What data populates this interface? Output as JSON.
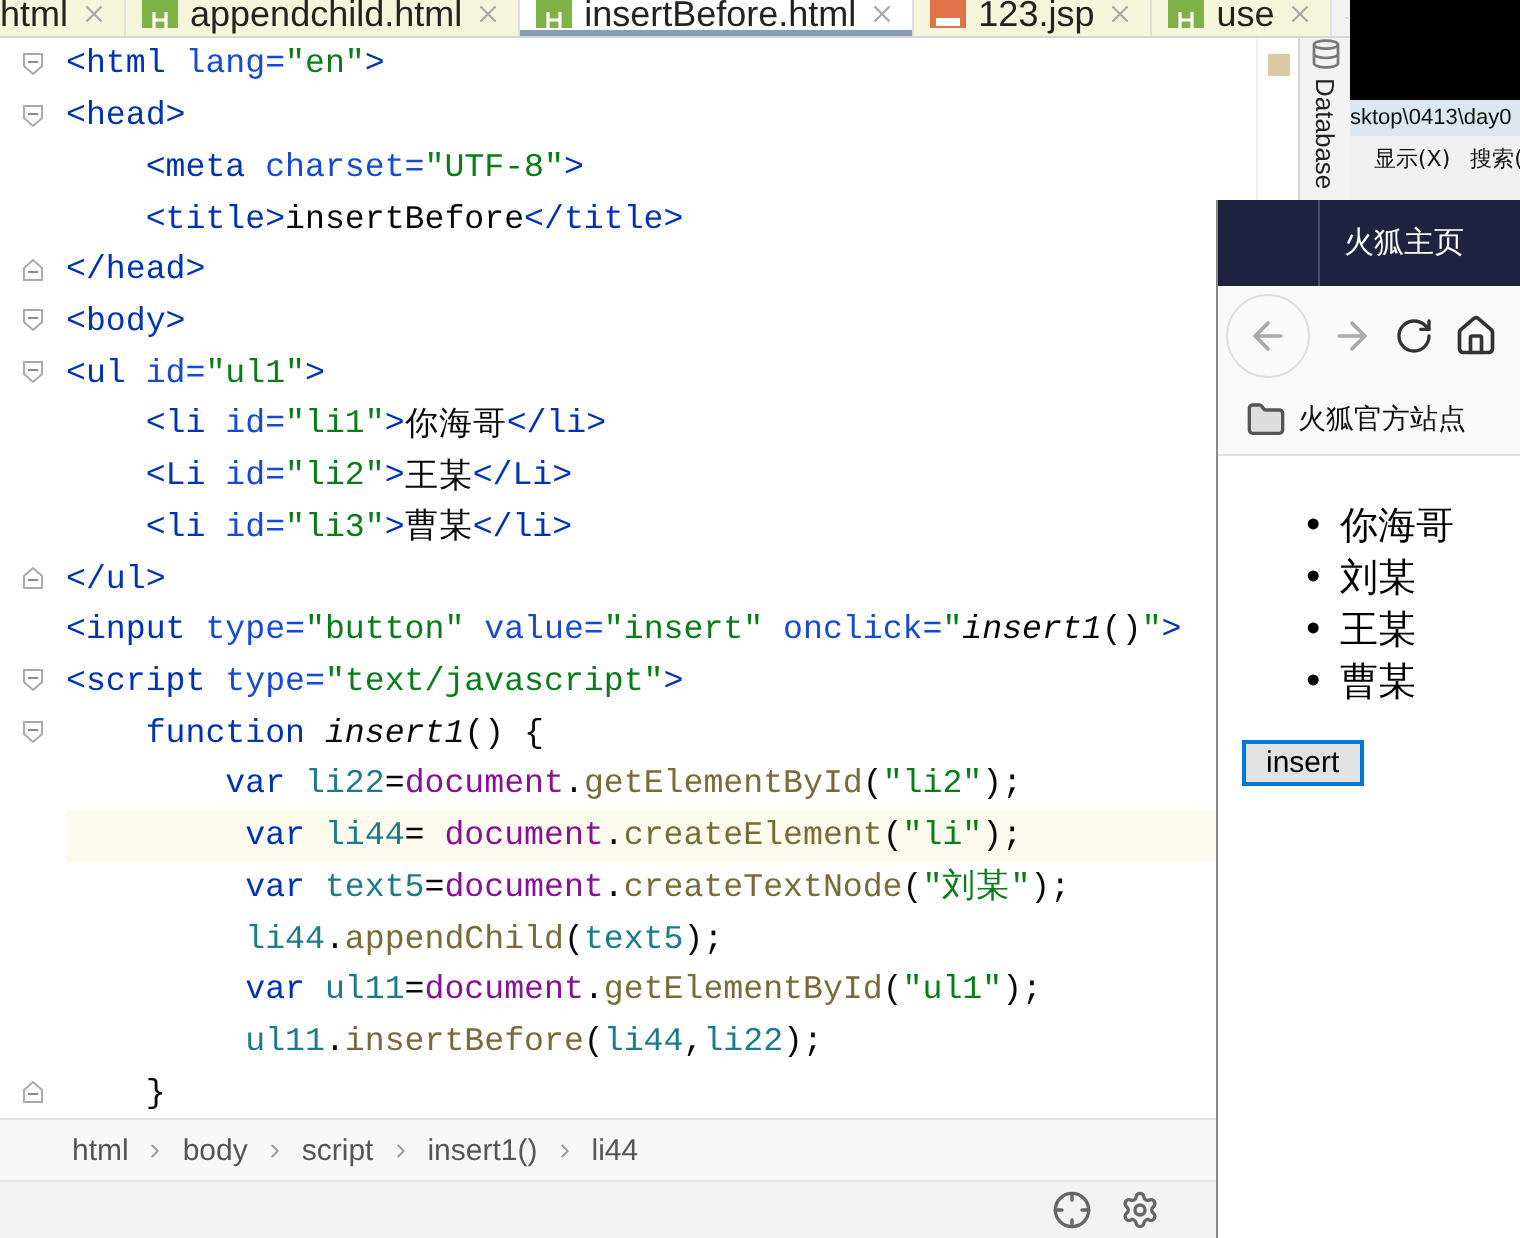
{
  "tabs": [
    {
      "label": "html",
      "kind": "cut",
      "selected": false
    },
    {
      "label": "appendchild.html",
      "kind": "html",
      "selected": false
    },
    {
      "label": "insertBefore.html",
      "kind": "html",
      "selected": true
    },
    {
      "label": "123.jsp",
      "kind": "jsp",
      "selected": false
    },
    {
      "label": "use",
      "kind": "html",
      "selected": false
    }
  ],
  "side_panel": {
    "label": "Database"
  },
  "editor": {
    "lines": [
      {
        "kind": "opening",
        "highlighted": false,
        "tokens": [
          {
            "kind": "tag",
            "text": "<html "
          },
          {
            "kind": "attr",
            "text": "lang="
          },
          {
            "kind": "str",
            "text": "\"en\""
          },
          {
            "kind": "tag",
            "text": ">"
          }
        ]
      },
      {
        "kind": "opening",
        "highlighted": false,
        "tokens": [
          {
            "kind": "tag",
            "text": "<head>"
          }
        ]
      },
      {
        "kind": "plain",
        "highlighted": false,
        "tokens": [
          {
            "kind": "tag",
            "text": "    <meta "
          },
          {
            "kind": "attr",
            "text": "charset="
          },
          {
            "kind": "str",
            "text": "\"UTF-8\""
          },
          {
            "kind": "tag",
            "text": ">"
          }
        ]
      },
      {
        "kind": "plain",
        "highlighted": false,
        "tokens": [
          {
            "kind": "tag",
            "text": "    <title>"
          },
          {
            "kind": "text",
            "text": "insertBefore"
          },
          {
            "kind": "tag",
            "text": "</title>"
          }
        ]
      },
      {
        "kind": "closing",
        "highlighted": false,
        "tokens": [
          {
            "kind": "tag",
            "text": "</head>"
          }
        ]
      },
      {
        "kind": "opening",
        "highlighted": false,
        "tokens": [
          {
            "kind": "tag",
            "text": "<body>"
          }
        ]
      },
      {
        "kind": "opening",
        "highlighted": false,
        "tokens": [
          {
            "kind": "tag",
            "text": "<ul "
          },
          {
            "kind": "attr",
            "text": "id="
          },
          {
            "kind": "str",
            "text": "\"ul1\""
          },
          {
            "kind": "tag",
            "text": ">"
          }
        ]
      },
      {
        "kind": "plain",
        "highlighted": false,
        "tokens": [
          {
            "kind": "tag",
            "text": "    <li "
          },
          {
            "kind": "attr",
            "text": "id="
          },
          {
            "kind": "str",
            "text": "\"li1\""
          },
          {
            "kind": "tag",
            "text": ">"
          },
          {
            "kind": "text",
            "text": "你海哥"
          },
          {
            "kind": "tag",
            "text": "</li>"
          }
        ]
      },
      {
        "kind": "plain",
        "highlighted": false,
        "tokens": [
          {
            "kind": "tag",
            "text": "    <Li "
          },
          {
            "kind": "attr",
            "text": "id="
          },
          {
            "kind": "str",
            "text": "\"li2\""
          },
          {
            "kind": "tag",
            "text": ">"
          },
          {
            "kind": "text",
            "text": "王某"
          },
          {
            "kind": "tag",
            "text": "</Li>"
          }
        ]
      },
      {
        "kind": "plain",
        "highlighted": false,
        "tokens": [
          {
            "kind": "tag",
            "text": "    <li "
          },
          {
            "kind": "attr",
            "text": "id="
          },
          {
            "kind": "str",
            "text": "\"li3\""
          },
          {
            "kind": "tag",
            "text": ">"
          },
          {
            "kind": "text",
            "text": "曹某"
          },
          {
            "kind": "tag",
            "text": "</li>"
          }
        ]
      },
      {
        "kind": "closing",
        "highlighted": false,
        "tokens": [
          {
            "kind": "tag",
            "text": "</ul>"
          }
        ]
      },
      {
        "kind": "plain",
        "highlighted": false,
        "tokens": [
          {
            "kind": "tag",
            "text": "<input "
          },
          {
            "kind": "attr",
            "text": "type="
          },
          {
            "kind": "str",
            "text": "\"button\""
          },
          {
            "kind": "attr",
            "text": " value="
          },
          {
            "kind": "str",
            "text": "\"insert\""
          },
          {
            "kind": "attr",
            "text": " onclick="
          },
          {
            "kind": "str",
            "text": "\""
          },
          {
            "kind": "fn",
            "text": "insert1"
          },
          {
            "kind": "text",
            "text": "()"
          },
          {
            "kind": "str",
            "text": "\""
          },
          {
            "kind": "tag",
            "text": ">"
          }
        ]
      },
      {
        "kind": "opening",
        "highlighted": false,
        "tokens": [
          {
            "kind": "tag",
            "text": "<script "
          },
          {
            "kind": "attr",
            "text": "type="
          },
          {
            "kind": "str",
            "text": "\"text/javascript\""
          },
          {
            "kind": "tag",
            "text": ">"
          }
        ]
      },
      {
        "kind": "opening",
        "highlighted": false,
        "tokens": [
          {
            "kind": "kw",
            "text": "    function "
          },
          {
            "kind": "fn",
            "text": "insert1"
          },
          {
            "kind": "text",
            "text": "() {"
          }
        ]
      },
      {
        "kind": "plain",
        "highlighted": false,
        "tokens": [
          {
            "kind": "kw",
            "text": "        var "
          },
          {
            "kind": "ident",
            "text": "li22"
          },
          {
            "kind": "text",
            "text": "="
          },
          {
            "kind": "obj",
            "text": "document"
          },
          {
            "kind": "text",
            "text": "."
          },
          {
            "kind": "method",
            "text": "getElementById"
          },
          {
            "kind": "text",
            "text": "("
          },
          {
            "kind": "str",
            "text": "\"li2\""
          },
          {
            "kind": "text",
            "text": ");"
          }
        ]
      },
      {
        "kind": "plain",
        "highlighted": true,
        "tokens": [
          {
            "kind": "kw",
            "text": "         var "
          },
          {
            "kind": "ident",
            "text": "li44"
          },
          {
            "kind": "text",
            "text": "= "
          },
          {
            "kind": "obj",
            "text": "document"
          },
          {
            "kind": "text",
            "text": "."
          },
          {
            "kind": "method",
            "text": "createElement"
          },
          {
            "kind": "text",
            "text": "("
          },
          {
            "kind": "str",
            "text": "\"li\""
          },
          {
            "kind": "text",
            "text": ");"
          }
        ]
      },
      {
        "kind": "plain",
        "highlighted": false,
        "tokens": [
          {
            "kind": "kw",
            "text": "         var "
          },
          {
            "kind": "ident",
            "text": "text5"
          },
          {
            "kind": "text",
            "text": "="
          },
          {
            "kind": "obj",
            "text": "document"
          },
          {
            "kind": "text",
            "text": "."
          },
          {
            "kind": "method",
            "text": "createTextNode"
          },
          {
            "kind": "text",
            "text": "("
          },
          {
            "kind": "str",
            "text": "\"刘某\""
          },
          {
            "kind": "text",
            "text": ");"
          }
        ]
      },
      {
        "kind": "plain",
        "highlighted": false,
        "tokens": [
          {
            "kind": "ident",
            "text": "         li44"
          },
          {
            "kind": "text",
            "text": "."
          },
          {
            "kind": "method",
            "text": "appendChild"
          },
          {
            "kind": "text",
            "text": "("
          },
          {
            "kind": "ident",
            "text": "text5"
          },
          {
            "kind": "text",
            "text": ");"
          }
        ]
      },
      {
        "kind": "plain",
        "highlighted": false,
        "tokens": [
          {
            "kind": "kw",
            "text": "         var "
          },
          {
            "kind": "ident",
            "text": "ul11"
          },
          {
            "kind": "text",
            "text": "="
          },
          {
            "kind": "obj",
            "text": "document"
          },
          {
            "kind": "text",
            "text": "."
          },
          {
            "kind": "method",
            "text": "getElementById"
          },
          {
            "kind": "text",
            "text": "("
          },
          {
            "kind": "str",
            "text": "\"ul1\""
          },
          {
            "kind": "text",
            "text": ");"
          }
        ]
      },
      {
        "kind": "plain",
        "highlighted": false,
        "tokens": [
          {
            "kind": "ident",
            "text": "         ul11"
          },
          {
            "kind": "text",
            "text": "."
          },
          {
            "kind": "method",
            "text": "insertBefore"
          },
          {
            "kind": "text",
            "text": "("
          },
          {
            "kind": "ident",
            "text": "li44"
          },
          {
            "kind": "text",
            "text": ","
          },
          {
            "kind": "ident",
            "text": "li22"
          },
          {
            "kind": "text",
            "text": ");"
          }
        ]
      },
      {
        "kind": "closing",
        "highlighted": false,
        "tokens": [
          {
            "kind": "text",
            "text": "    }"
          }
        ]
      }
    ]
  },
  "breadcrumbs": [
    "html",
    "body",
    "script",
    "insert1()",
    "li44"
  ],
  "explorer": {
    "path": "sktop\\0413\\day0",
    "menu": [
      "显示(X)",
      "搜索("
    ]
  },
  "browser": {
    "tab": "火狐主页",
    "bookmark": "火狐官方站点",
    "list": [
      {
        "bullet": "•",
        "text": "你海哥"
      },
      {
        "bullet": "•",
        "text": "刘某"
      },
      {
        "bullet": "•",
        "text": "王某"
      },
      {
        "bullet": "•",
        "text": "曹某"
      }
    ],
    "button": "insert"
  }
}
